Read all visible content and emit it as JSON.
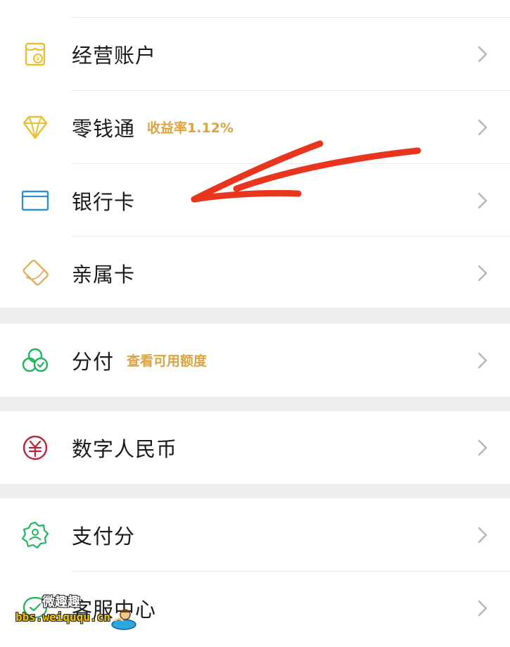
{
  "groups": [
    {
      "items": [
        {
          "label": "经营账户",
          "icon": "shop-account-icon"
        },
        {
          "label": "零钱通",
          "tag": "收益率1.12%",
          "icon": "diamond-icon"
        },
        {
          "label": "银行卡",
          "icon": "bank-card-icon"
        },
        {
          "label": "亲属卡",
          "icon": "family-card-icon"
        }
      ]
    },
    {
      "items": [
        {
          "label": "分付",
          "tag": "查看可用额度",
          "icon": "fenfu-icon"
        }
      ]
    },
    {
      "items": [
        {
          "label": "数字人民币",
          "icon": "digital-rmb-icon"
        }
      ]
    },
    {
      "items": [
        {
          "label": "支付分",
          "icon": "pay-score-icon"
        },
        {
          "label": "客服中心",
          "icon": "customer-service-icon"
        }
      ]
    }
  ],
  "colors": {
    "tag": "#d9a441",
    "icon_gold": "#e6c032",
    "icon_blue": "#2f8fcf",
    "icon_orange": "#e4b055",
    "icon_green": "#22b45c",
    "icon_red": "#b82538",
    "annotation_red": "#e8351e",
    "chevron": "#b8b8b8"
  },
  "watermark": {
    "title": "微趣趣",
    "url": "bbs.weiququ.cn"
  }
}
